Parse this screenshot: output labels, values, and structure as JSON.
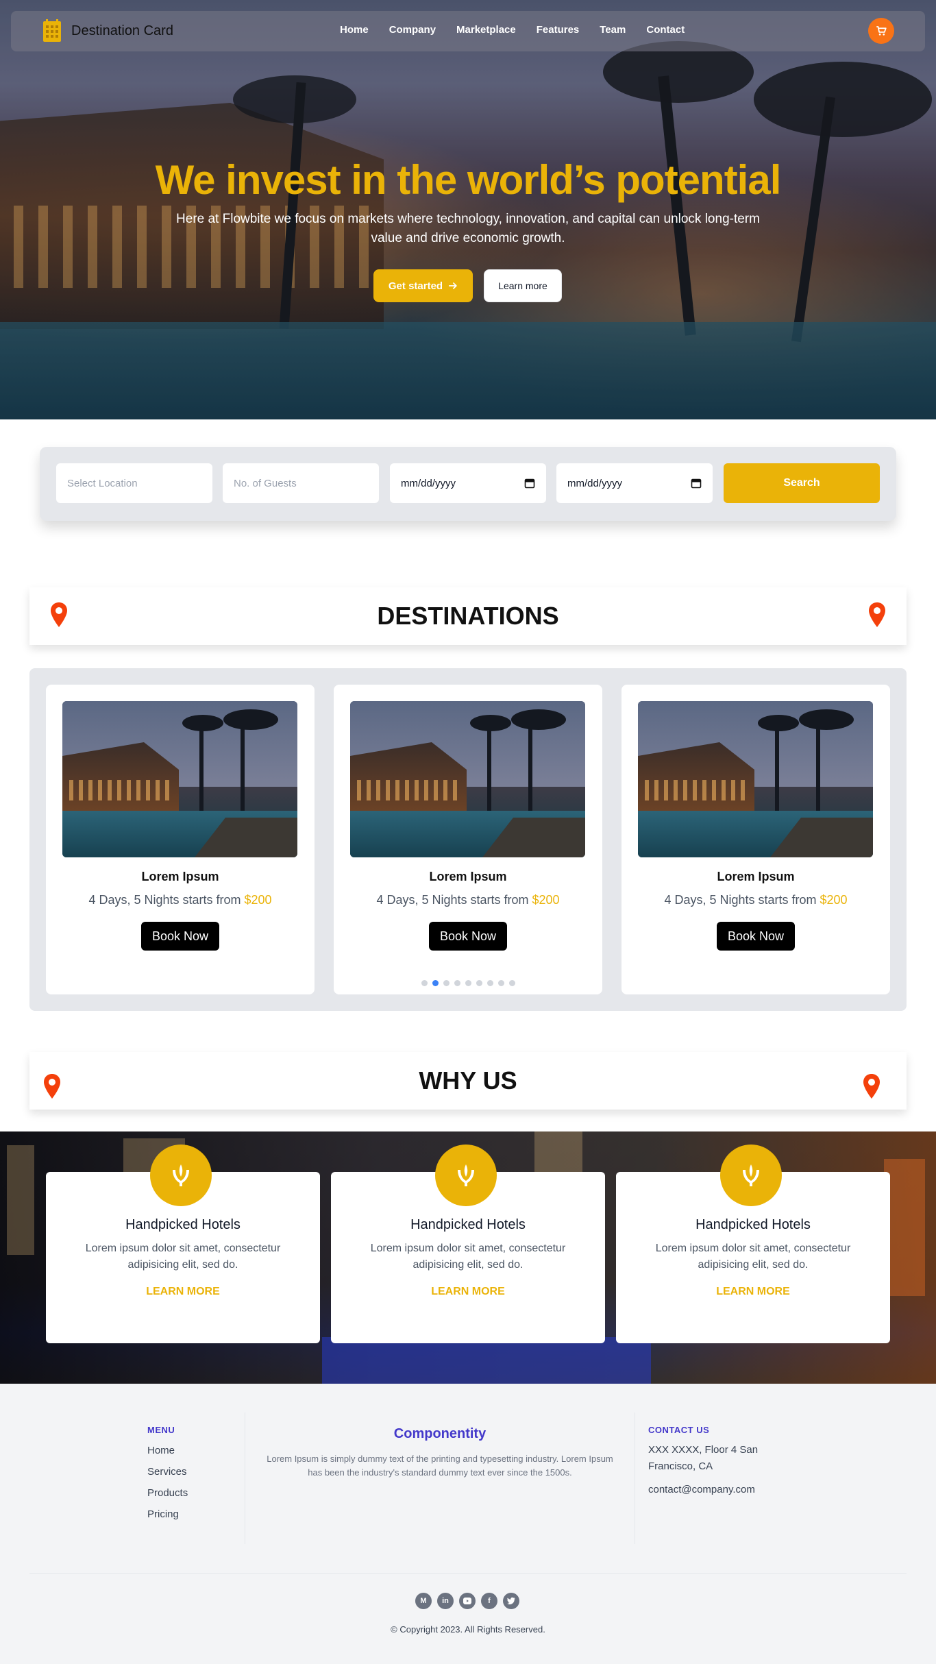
{
  "nav": {
    "brand": "Destination Card",
    "links": [
      "Home",
      "Company",
      "Marketplace",
      "Features",
      "Team",
      "Contact"
    ]
  },
  "hero": {
    "title": "We invest in the world’s potential",
    "subtitle": "Here at Flowbite we focus on markets where technology, innovation, and capital can unlock long-term value and drive economic growth.",
    "primary_button": "Get started",
    "secondary_button": "Learn more"
  },
  "search": {
    "location_placeholder": "Select Location",
    "guests_placeholder": "No. of Guests",
    "checkin_value": "mm/dd/yyyy",
    "checkout_value": "mm/dd/yyyy",
    "button": "Search"
  },
  "destinations": {
    "title": "DESTINATIONS",
    "cards": [
      {
        "name": "Lorem Ipsum",
        "desc": "4 Days, 5 Nights starts from ",
        "price": "$200",
        "button": "Book Now"
      },
      {
        "name": "Lorem Ipsum",
        "desc": "4 Days, 5 Nights starts from ",
        "price": "$200",
        "button": "Book Now"
      },
      {
        "name": "Lorem Ipsum",
        "desc": "4 Days, 5 Nights starts from ",
        "price": "$200",
        "button": "Book Now"
      }
    ],
    "carousel_dots": 9,
    "active_dot": 1
  },
  "why_us": {
    "title": "WHY US",
    "cards": [
      {
        "title": "Handpicked Hotels",
        "text": "Lorem ipsum dolor sit amet, consectetur adipisicing elit, sed do.",
        "link": "LEARN MORE"
      },
      {
        "title": "Handpicked Hotels",
        "text": "Lorem ipsum dolor sit amet, consectetur adipisicing elit, sed do.",
        "link": "LEARN MORE"
      },
      {
        "title": "Handpicked Hotels",
        "text": "Lorem ipsum dolor sit amet, consectetur adipisicing elit, sed do.",
        "link": "LEARN MORE"
      }
    ]
  },
  "footer": {
    "menu_heading": "MENU",
    "menu": [
      "Home",
      "Services",
      "Products",
      "Pricing"
    ],
    "brand": "Componentity",
    "about": "Lorem Ipsum is simply dummy text of the printing and typesetting industry. Lorem Ipsum has been the industry's standard dummy text ever since the 1500s.",
    "contact_heading": "CONTACT US",
    "address": "XXX XXXX, Floor 4 San Francisco, CA",
    "email": "contact@company.com",
    "socials": [
      "medium",
      "linkedin",
      "youtube",
      "facebook",
      "twitter"
    ],
    "copyright": "© Copyright 2023. All Rights Reserved."
  },
  "colors": {
    "accent": "#eab308",
    "cart": "#f97316",
    "pin": "#f4400b",
    "footer_heading": "#4338ca",
    "carousel_active": "#3b82f6"
  },
  "icons": {
    "logo": "building-icon",
    "cart": "cart-icon",
    "arrow": "arrow-right-icon",
    "pin": "map-pin-icon",
    "why": "hotel-emblem-icon"
  }
}
